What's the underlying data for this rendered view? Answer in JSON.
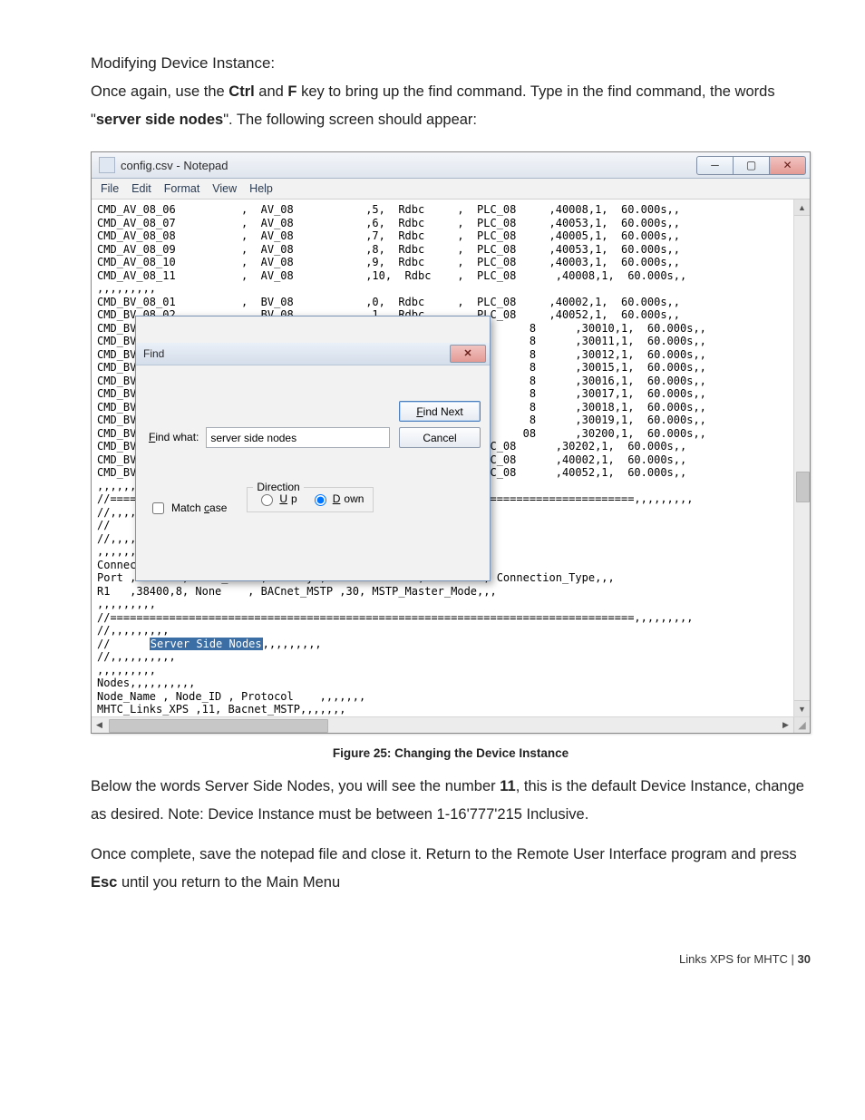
{
  "doc": {
    "heading": "Modifying Device Instance:",
    "para1_a": "Once again, use the ",
    "para1_ctrl": "Ctrl",
    "para1_b": " and ",
    "para1_f": "F",
    "para1_c": " key to bring up the find command. Type in the find command, the words \"",
    "para1_ssn": "server side nodes",
    "para1_d": "\". The following  screen should appear:",
    "caption": "Figure 25: Changing the Device Instance",
    "para2_a": "Below the words Server Side Nodes, you will see the number ",
    "para2_num": "11",
    "para2_b": ", this is the default Device Instance, change as desired.  Note: Device Instance must be between 1-16'777'215 Inclusive.",
    "para3_a": "Once complete, save the notepad file and close it. Return to the Remote User Interface program and press ",
    "para3_esc": "Esc",
    "para3_b": " until you return to the Main Menu",
    "footer_text": "Links XPS for MHTC | ",
    "footer_page": "30"
  },
  "notepad": {
    "title": "config.csv - Notepad",
    "menus": [
      "File",
      "Edit",
      "Format",
      "View",
      "Help"
    ],
    "highlight": "Server Side Nodes",
    "text_before": "CMD_AV_08_06          ,  AV_08           ,5,  Rdbc     ,  PLC_08     ,40008,1,  60.000s,,\nCMD_AV_08_07          ,  AV_08           ,6,  Rdbc     ,  PLC_08     ,40053,1,  60.000s,,\nCMD_AV_08_08          ,  AV_08           ,7,  Rdbc     ,  PLC_08     ,40005,1,  60.000s,,\nCMD_AV_08_09          ,  AV_08           ,8,  Rdbc     ,  PLC_08     ,40053,1,  60.000s,,\nCMD_AV_08_10          ,  AV_08           ,9,  Rdbc     ,  PLC_08     ,40003,1,  60.000s,,\nCMD_AV_08_11          ,  AV_08           ,10,  Rdbc    ,  PLC_08      ,40008,1,  60.000s,,\n,,,,,,,,,\nCMD_BV_08_01          ,  BV_08           ,0,  Rdbc     ,  PLC_08     ,40002,1,  60.000s,,\nCMD_BV_08_02          ,  BV_08           ,1,  Rdbc     ,  PLC_08     ,40052,1,  60.000s,,\nCMD_BV                                                            8      ,30010,1,  60.000s,,\nCMD_BV                                                            8      ,30011,1,  60.000s,,\nCMD_BV                                                            8      ,30012,1,  60.000s,,\nCMD_BV                                                            8      ,30015,1,  60.000s,,\nCMD_BV                                                            8      ,30016,1,  60.000s,,\nCMD_BV                                                            8      ,30017,1,  60.000s,,\nCMD_BV                                                            8      ,30018,1,  60.000s,,\nCMD_BV                                                            8      ,30019,1,  60.000s,,\nCMD_BV                                                           08      ,30200,1,  60.000s,,\nCMD_BV_08_12          ,  BV_08           ,11,  Rdbc    ,  PLC_08      ,30202,1,  60.000s,,\nCMD_BV_08_13          ,  BV_08           ,12,  Rdbc    ,  PLC_08      ,40002,1,  60.000s,,\nCMD_BV_08_14          ,  BV_08           ,13,  Rdbc    ,  PLC_08      ,40052,1,  60.000s,,\n,,,,,,,,,\n//================================================================================,,,,,,,,,\n//,,,,,,,,,\n//      Server Side Connections,,,,,,,,,\n//,,,,,,,,,\n,,,,,,,,,\nConnections,,,,,,,,,\nPort , Baud  , Data_Bits , Parity , Protocol     , Timeout , Connection_Type,,,\nR1   ,38400,8, None    , BACnet_MSTP ,30, MSTP_Master_Mode,,,\n,,,,,,,,,\n//================================================================================,,,,,,,,,\n//,,,,,,,,,\n//      ",
    "text_after": ",,,,,,,,,\n//,,,,,,,,,,\n,,,,,,,,,\nNodes,,,,,,,,,,\nNode_Name , Node_ID , Protocol    ,,,,,,,\nMHTC_Links_XPS ,11, Bacnet_MSTP,,,,,,,\n,,,,,,,,,\n//================================================================================,,,,,,,,,\n//,,,,,,,,,,"
  },
  "find": {
    "title": "Find",
    "label": "Find what:",
    "value": "server side nodes",
    "match_case_label": "Match case",
    "direction_label": "Direction",
    "up_label": "Up",
    "down_label": "Down",
    "find_next": "Find Next",
    "cancel": "Cancel"
  }
}
